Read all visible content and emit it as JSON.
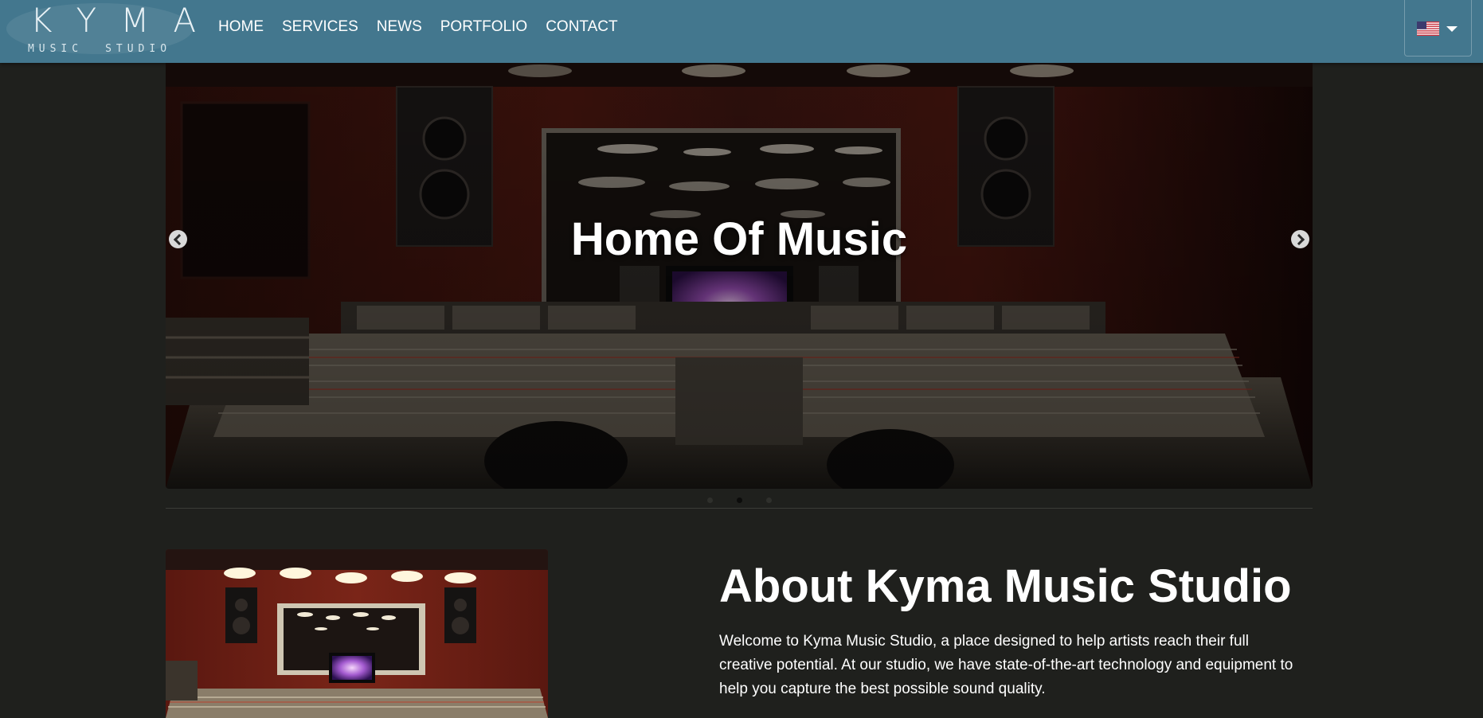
{
  "brand": {
    "logo_text": "KYMA",
    "sub_left": "MUSIC",
    "sub_right": "STUDIO"
  },
  "nav": {
    "items": [
      {
        "label": "HOME"
      },
      {
        "label": "SERVICES"
      },
      {
        "label": "NEWS"
      },
      {
        "label": "PORTFOLIO"
      },
      {
        "label": "CONTACT"
      }
    ],
    "language": {
      "selected": "English (US)",
      "icon": "us-flag-icon"
    }
  },
  "carousel": {
    "slide_title": "Home Of Music",
    "prev_icon": "chevron-left-icon",
    "next_icon": "chevron-right-icon",
    "slide_count": 3,
    "active_index": 1
  },
  "about": {
    "title": "About Kyma Music Studio",
    "text": "Welcome to Kyma Music Studio, a place designed to help artists reach their full creative potential. At our studio, we have state-of-the-art technology and equipment to help you capture the best possible sound quality."
  },
  "colors": {
    "navbar": "#43778e",
    "page_bg": "#1f201d",
    "studio_wall": "#6b1e14"
  }
}
